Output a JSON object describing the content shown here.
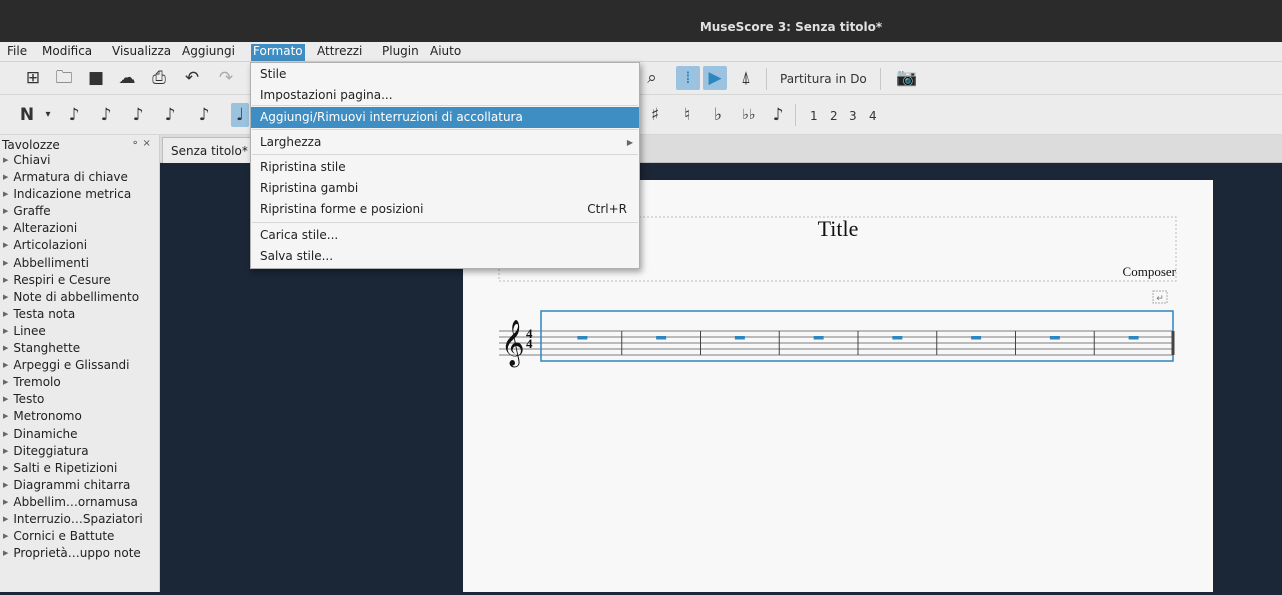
{
  "window": {
    "title": "MuseScore 3: Senza titolo*"
  },
  "menubar": {
    "items": [
      "File",
      "Modifica",
      "Visualizza",
      "Aggiungi",
      "Formato",
      "Attrezzi",
      "Plugin",
      "Aiuto"
    ],
    "active": "Formato"
  },
  "toolbar": {
    "concert_pitch_label": "Partitura in Do",
    "voice_numbers": [
      "1",
      "2",
      "3",
      "4"
    ]
  },
  "formato_menu": {
    "items": [
      {
        "label": "Stile",
        "shortcut": "",
        "submenu": false,
        "highlighted": false
      },
      {
        "label": "Impostazioni pagina...",
        "shortcut": "",
        "submenu": false,
        "highlighted": false
      },
      {
        "label": "Aggiungi/Rimuovi interruzioni di accollatura",
        "shortcut": "",
        "submenu": false,
        "highlighted": true
      },
      {
        "label": "Larghezza",
        "shortcut": "",
        "submenu": true,
        "highlighted": false
      },
      {
        "label": "Ripristina stile",
        "shortcut": "",
        "submenu": false,
        "highlighted": false
      },
      {
        "label": "Ripristina gambi",
        "shortcut": "",
        "submenu": false,
        "highlighted": false
      },
      {
        "label": "Ripristina forme e posizioni",
        "shortcut": "Ctrl+R",
        "submenu": false,
        "highlighted": false
      },
      {
        "label": "Carica stile...",
        "shortcut": "",
        "submenu": false,
        "highlighted": false
      },
      {
        "label": "Salva stile...",
        "shortcut": "",
        "submenu": false,
        "highlighted": false
      }
    ]
  },
  "palette": {
    "title": "Tavolozze",
    "items": [
      "Chiavi",
      "Armatura di chiave",
      "Indicazione metrica",
      "Graffe",
      "Alterazioni",
      "Articolazioni",
      "Abbellimenti",
      "Respiri e Cesure",
      "Note di abbellimento",
      "Testa nota",
      "Linee",
      "Stanghette",
      "Arpeggi e Glissandi",
      "Tremolo",
      "Testo",
      "Metronomo",
      "Dinamiche",
      "Diteggiatura",
      "Salti e Ripetizioni",
      "Diagrammi chitarra",
      "Abbellim…ornamusa",
      "Interruzio…Spaziatori",
      "Cornici e Battute",
      "Proprietà…uppo note"
    ]
  },
  "tabs": [
    {
      "label": "Senza titolo*"
    }
  ],
  "score": {
    "title": "Title",
    "composer": "Composer",
    "time_signature": {
      "numerator": "4",
      "denominator": "4"
    },
    "measures": 8
  },
  "colors": {
    "accent": "#3e8ec3",
    "canvas": "#1b2636",
    "selection": "#2e86c1"
  }
}
